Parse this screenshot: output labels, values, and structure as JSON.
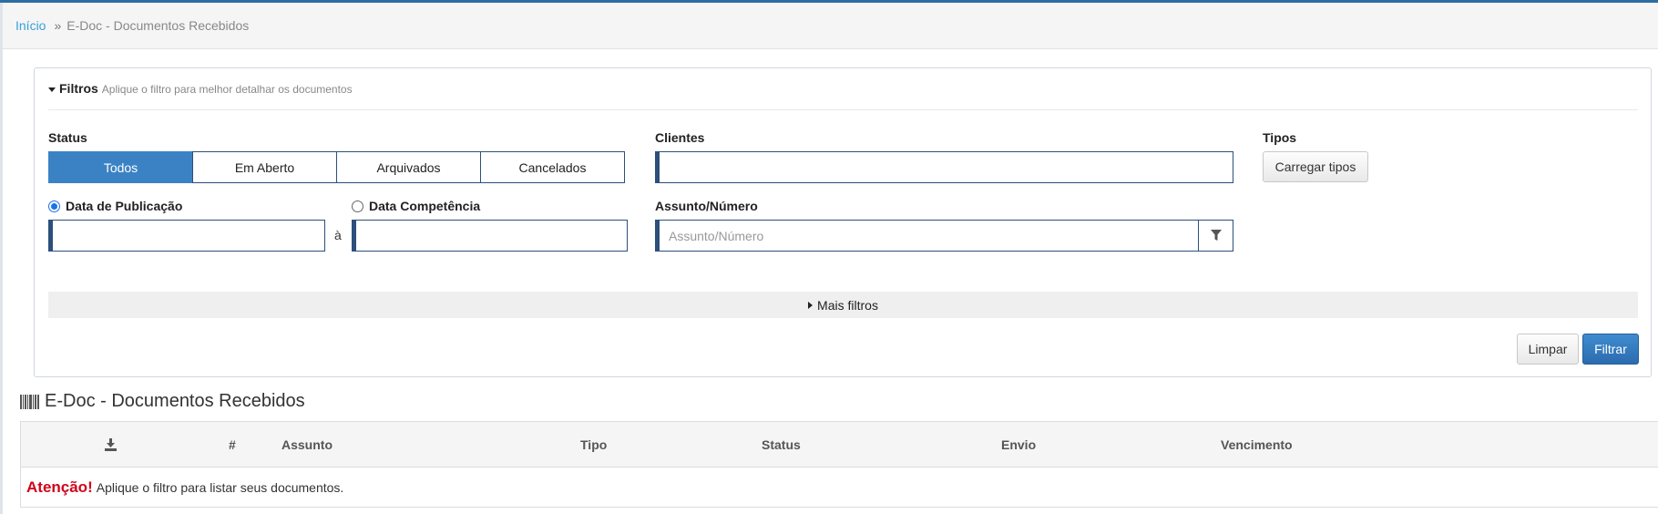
{
  "breadcrumb": {
    "home": "Início",
    "separator": "»",
    "current": "E-Doc - Documentos Recebidos"
  },
  "filters": {
    "title": "Filtros",
    "subtitle": "Aplique o filtro para melhor detalhar os documentos",
    "status_label": "Status",
    "status_options": [
      "Todos",
      "Em Aberto",
      "Arquivados",
      "Cancelados"
    ],
    "status_selected": "Todos",
    "clientes_label": "Clientes",
    "clientes_value": "",
    "tipos_label": "Tipos",
    "load_types_button": "Carregar tipos",
    "date_pub_label": "Data de Publicação",
    "date_comp_label": "Data Competência",
    "date_mode_selected": "Data de Publicação",
    "date_sep": "à",
    "date_from": "",
    "date_to": "",
    "assunto_label": "Assunto/Número",
    "assunto_placeholder": "Assunto/Número",
    "more_filters": "Mais filtros",
    "clear_button": "Limpar",
    "filter_button": "Filtrar"
  },
  "section": {
    "title": "E-Doc - Documentos Recebidos",
    "icon": "barcode-icon"
  },
  "table": {
    "download_icon": "download-icon",
    "columns": [
      "#",
      "Assunto",
      "Tipo",
      "Status",
      "Envio",
      "Vencimento"
    ],
    "empty_prefix": "Atenção!",
    "empty_message": "Aplique o filtro para listar seus documentos."
  },
  "colors": {
    "accent": "#3b82c4",
    "border": "#2c4f7c",
    "link": "#3aa0d8",
    "warning": "#d0021b"
  }
}
